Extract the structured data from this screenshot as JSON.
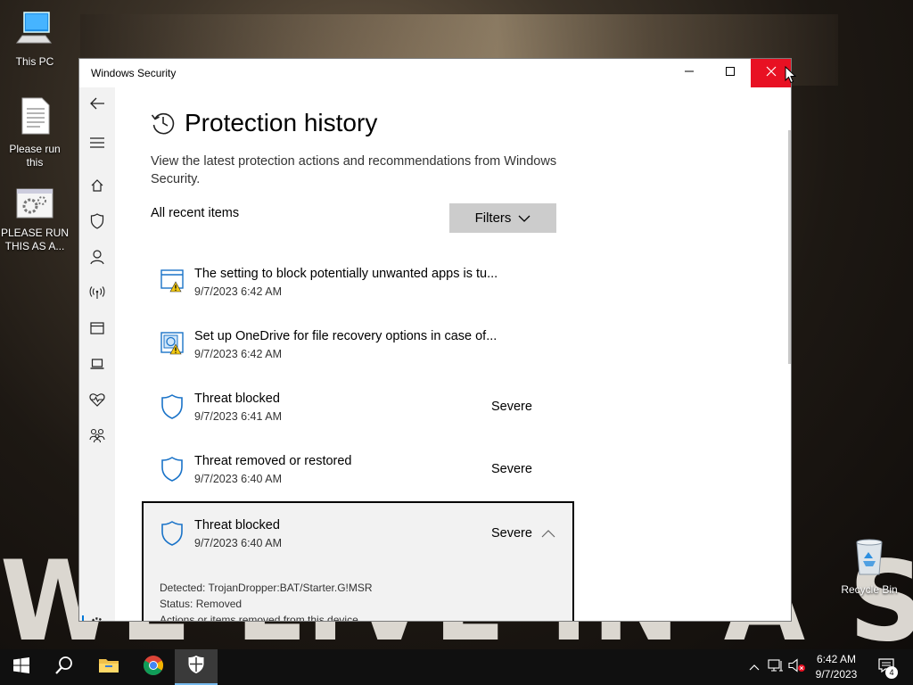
{
  "desktop": {
    "icons": [
      {
        "label": "This PC",
        "icon": "computer-icon"
      },
      {
        "label": "Please run this",
        "icon": "text-file-icon"
      },
      {
        "label": "PLEASE RUN THIS AS A...",
        "icon": "settings-file-icon"
      },
      {
        "label": "Recycle Bin",
        "icon": "recycle-bin-icon"
      }
    ],
    "wallpaper_text": "WE LIVE IN A SOCIETY"
  },
  "window": {
    "title": "Windows Security",
    "controls": {
      "minimize": "minimize-icon",
      "maximize": "maximize-icon",
      "close": "close-icon"
    }
  },
  "sidebar": {
    "items": [
      "back-arrow-icon",
      "hamburger-menu-icon",
      "home-icon",
      "shield-icon",
      "person-icon",
      "wifi-antenna-icon",
      "app-browser-icon",
      "laptop-icon",
      "heart-health-icon",
      "family-icon",
      "settings-gear-icon"
    ]
  },
  "page": {
    "title": "Protection history",
    "description": "View the latest protection actions and recommendations from Windows Security.",
    "section_label": "All recent items",
    "filters_label": "Filters"
  },
  "history": [
    {
      "title": "The setting to block potentially unwanted apps is tu...",
      "date": "9/7/2023 6:42 AM",
      "severity": "",
      "icon": "app-warning-icon"
    },
    {
      "title": "Set up OneDrive for file recovery options in case of...",
      "date": "9/7/2023 6:42 AM",
      "severity": "",
      "icon": "recovery-warning-icon"
    },
    {
      "title": "Threat blocked",
      "date": "9/7/2023 6:41 AM",
      "severity": "Severe",
      "icon": "shield-outline-icon"
    },
    {
      "title": "Threat removed or restored",
      "date": "9/7/2023 6:40 AM",
      "severity": "Severe",
      "icon": "shield-outline-icon"
    },
    {
      "title": "Threat blocked",
      "date": "9/7/2023 6:40 AM",
      "severity": "Severe",
      "icon": "shield-outline-icon",
      "details": {
        "detected": "Detected:  TrojanDropper:BAT/Starter.G!MSR",
        "status": "Status:  Removed",
        "actions": "Actions or items removed from this device."
      }
    }
  ],
  "taskbar": {
    "apps": [
      "start-icon",
      "search-icon",
      "file-explorer-icon",
      "chrome-icon",
      "windows-security-icon"
    ],
    "time": "6:42 AM",
    "date": "9/7/2023",
    "notification_count": "4"
  },
  "colors": {
    "accent": "#0078d7",
    "close_red": "#e81123",
    "shield_blue": "#1a73c8"
  }
}
